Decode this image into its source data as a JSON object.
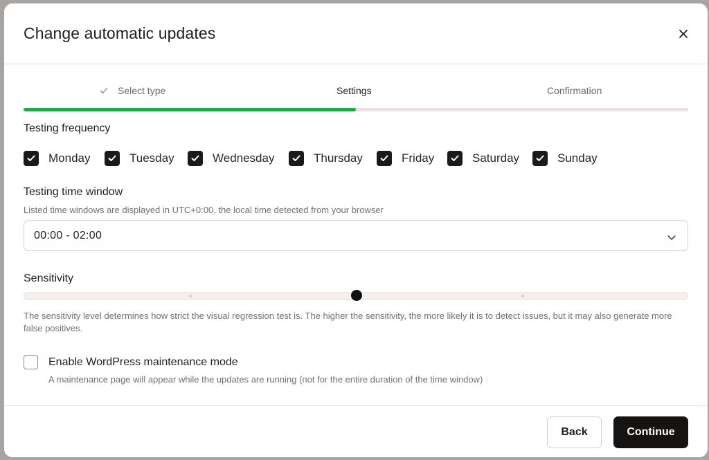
{
  "modal": {
    "title": "Change automatic updates",
    "close_icon": "close-icon"
  },
  "steps": {
    "items": [
      {
        "label": "Select type",
        "state": "done",
        "icon": "check-icon"
      },
      {
        "label": "Settings",
        "state": "active"
      },
      {
        "label": "Confirmation",
        "state": "pending"
      }
    ],
    "progress_percent": 50,
    "progress_color": "#21a84a"
  },
  "frequency": {
    "title": "Testing frequency",
    "days": [
      {
        "label": "Monday",
        "checked": true
      },
      {
        "label": "Tuesday",
        "checked": true
      },
      {
        "label": "Wednesday",
        "checked": true
      },
      {
        "label": "Thursday",
        "checked": true
      },
      {
        "label": "Friday",
        "checked": true
      },
      {
        "label": "Saturday",
        "checked": true
      },
      {
        "label": "Sunday",
        "checked": true
      }
    ]
  },
  "time_window": {
    "title": "Testing time window",
    "hint": "Listed time windows are displayed in UTC+0:00, the local time detected from your browser",
    "value": "00:00 - 02:00",
    "icon": "chevron-down-icon"
  },
  "sensitivity": {
    "title": "Sensitivity",
    "levels": 5,
    "selected_level": 3,
    "description": "The sensitivity level determines how strict the visual regression test is. The higher the sensitivity, the more likely it is to detect issues, but it may also generate more false positives."
  },
  "maintenance": {
    "label": "Enable WordPress maintenance mode",
    "hint": "A maintenance page will appear while the updates are running (not for the entire duration of the time window)",
    "checked": false
  },
  "footer": {
    "back_label": "Back",
    "continue_label": "Continue"
  }
}
